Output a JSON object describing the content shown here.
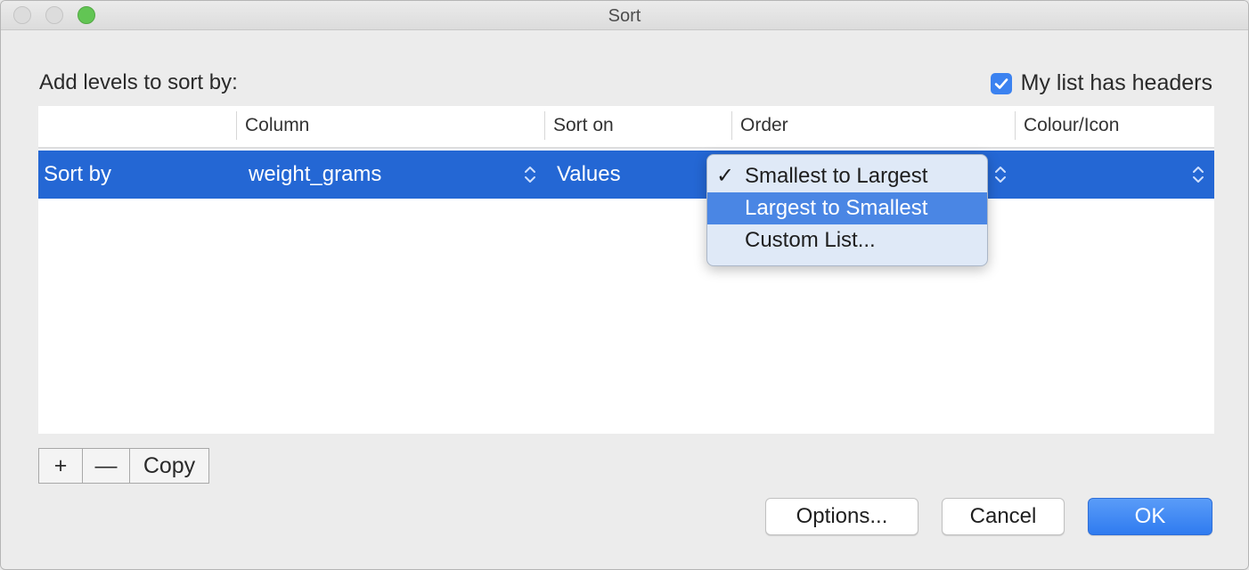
{
  "window": {
    "title": "Sort"
  },
  "dialog": {
    "prompt": "Add levels to sort by:",
    "headers_checkbox": {
      "label": "My list has headers",
      "checked": true
    }
  },
  "table": {
    "columns": [
      "",
      "Column",
      "Sort on",
      "Order",
      "Colour/Icon"
    ],
    "rows": [
      {
        "label": "Sort by",
        "column": "weight_grams",
        "sort_on": "Values",
        "order": "Smallest to Largest",
        "colour_icon": ""
      }
    ]
  },
  "order_dropdown": {
    "items": [
      {
        "label": "Smallest to Largest",
        "checked": true,
        "highlighted": false
      },
      {
        "label": "Largest to Smallest",
        "checked": false,
        "highlighted": true
      },
      {
        "label": "Custom List...",
        "checked": false,
        "highlighted": false
      }
    ],
    "checkmark": "✓"
  },
  "level_buttons": {
    "add": "+",
    "remove": "—",
    "copy": "Copy"
  },
  "footer_buttons": {
    "options": "Options...",
    "cancel": "Cancel",
    "ok": "OK"
  },
  "colors": {
    "selection": "#2467d4",
    "accent": "#3b82f0",
    "menu_highlight": "#4a86e4"
  }
}
